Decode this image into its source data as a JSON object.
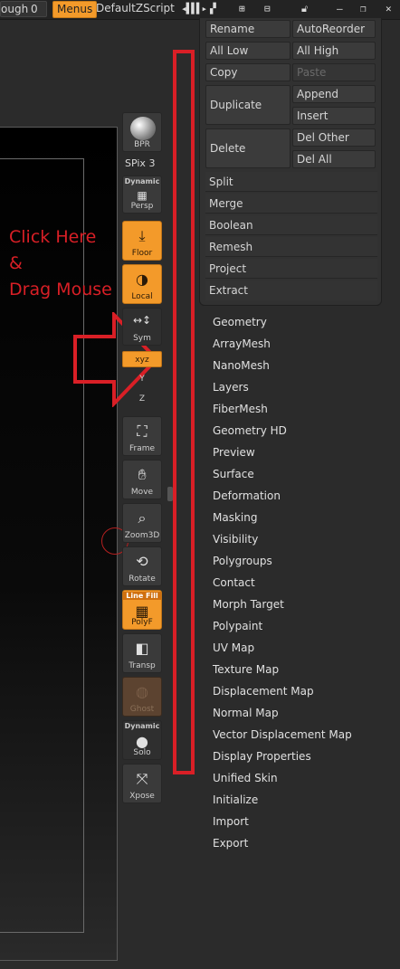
{
  "topbar": {
    "left_label": "ough",
    "left_value": "0",
    "menus_label": "Menus",
    "script_label": "DefaultZScript"
  },
  "annotation": {
    "line1": "Click Here",
    "line2": "&",
    "line3": "Drag Mouse",
    "color": "#d91f26"
  },
  "shelf": {
    "bpr": "BPR",
    "spix_label": "SPix",
    "spix_value": "3",
    "persp_tag": "Dynamic",
    "persp": "Persp",
    "floor": "Floor",
    "local": "Local",
    "sym": "Sym",
    "xyz": "xyz",
    "y_axis": "Y",
    "z_axis": "Z",
    "frame": "Frame",
    "move": "Move",
    "zoom3d": "Zoom3D",
    "rotate": "Rotate",
    "polyf_tag": "Line Fill",
    "polyf": "PolyF",
    "transp": "Transp",
    "ghost": "Ghost",
    "solo_tag": "Dynamic",
    "solo": "Solo",
    "xpose": "Xpose"
  },
  "toolpanel": {
    "rename": "Rename",
    "autoreorder": "AutoReorder",
    "all_low": "All Low",
    "all_high": "All High",
    "copy": "Copy",
    "paste": "Paste",
    "duplicate": "Duplicate",
    "append": "Append",
    "insert": "Insert",
    "delete": "Delete",
    "del_other": "Del Other",
    "del_all": "Del All",
    "rows": [
      "Split",
      "Merge",
      "Boolean",
      "Remesh",
      "Project",
      "Extract"
    ]
  },
  "subpalettes": [
    "Geometry",
    "ArrayMesh",
    "NanoMesh",
    "Layers",
    "FiberMesh",
    "Geometry HD",
    "Preview",
    "Surface",
    "Deformation",
    "Masking",
    "Visibility",
    "Polygroups",
    "Contact",
    "Morph Target",
    "Polypaint",
    "UV Map",
    "Texture Map",
    "Displacement Map",
    "Normal Map",
    "Vector Displacement Map",
    "Display Properties",
    "Unified Skin",
    "Initialize",
    "Import",
    "Export"
  ],
  "colors": {
    "accent_orange": "#f39a2a",
    "panel_bg": "#313131",
    "annotation_red": "#d91f26"
  }
}
